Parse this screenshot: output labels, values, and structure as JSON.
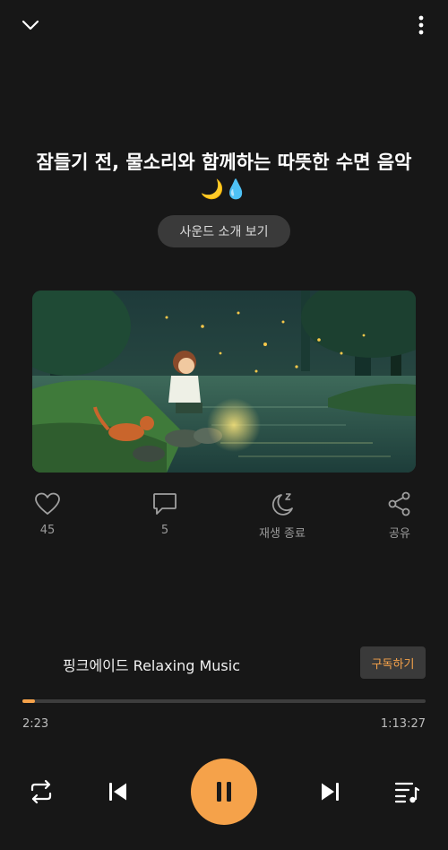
{
  "track": {
    "title": "잠들기 전, 물소리와 함께하는 따뜻한 수면 음악 🌙💧",
    "intro_button": "사운드 소개 보기"
  },
  "actions": {
    "like_count": "45",
    "comment_count": "5",
    "sleep_timer_label": "재생 종료",
    "share_label": "공유"
  },
  "channel": {
    "name": "핑크에이드 Relaxing Music",
    "subscribe_label": "구독하기"
  },
  "playback": {
    "current_time": "2:23",
    "total_time": "1:13:27",
    "progress_fraction": 0.032,
    "state": "playing"
  },
  "colors": {
    "accent": "#f5a24a",
    "background": "#171717"
  },
  "icons": [
    "chevron-down-icon",
    "more-vertical-icon",
    "heart-icon",
    "comment-icon",
    "sleep-timer-icon",
    "share-icon",
    "repeat-icon",
    "skip-previous-icon",
    "pause-icon",
    "skip-next-icon",
    "playlist-icon"
  ]
}
